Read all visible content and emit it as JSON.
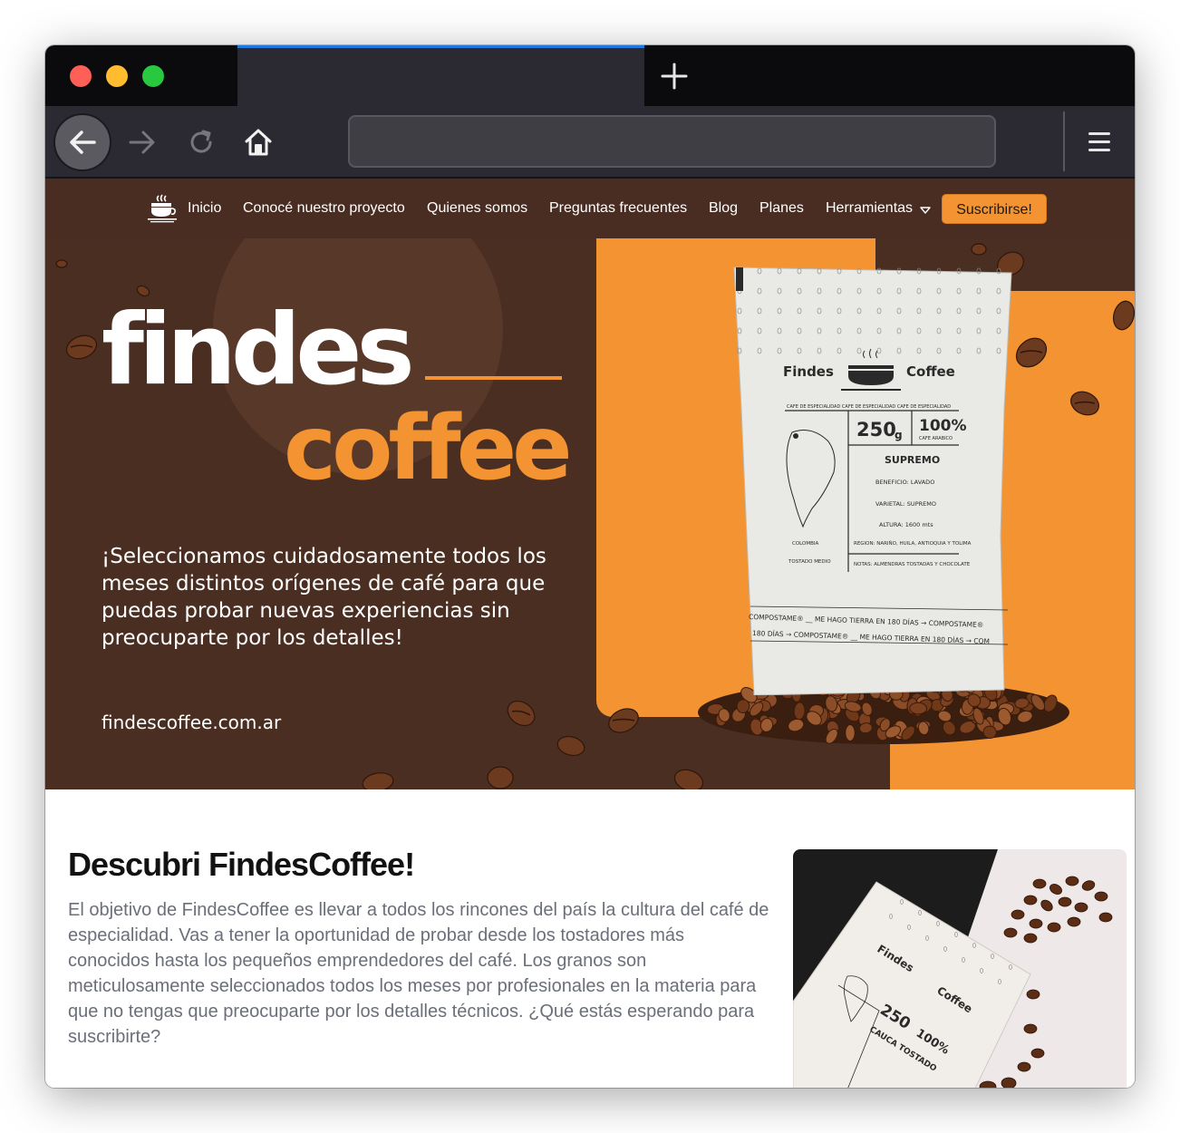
{
  "browser": {
    "tab_title": "",
    "url": "",
    "new_tab_icon": "plus-icon",
    "colors": {
      "tabbar": "#0b0b0d",
      "toolbar": "#2b2a33",
      "active_tab_accent": "#1f7ae0"
    }
  },
  "nav": {
    "items": [
      "Inicio",
      "Conocé nuestro proyecto",
      "Quienes somos",
      "Preguntas frecuentes",
      "Blog",
      "Planes",
      "Herramientas"
    ],
    "subscribe_label": "Suscribirse!",
    "colors": {
      "background": "#4a2d22",
      "accent": "#f39331"
    }
  },
  "hero": {
    "title": "findes",
    "subtitle": "coffee",
    "text": "¡Seleccionamos cuidadosamente todos los meses distintos orígenes de café para que puedas probar nuevas experiencias sin preocuparte por los detalles!",
    "url": "findescoffee.com.ar",
    "bag": {
      "brand_left": "Findes",
      "brand_right": "Coffee",
      "weight": "250",
      "weight_unit": "g",
      "percent": "100%",
      "percent_sub": "CAFE ARABICO",
      "band": "CAFE DE ESPECIALIDAD  CAFE DE ESPECIALIDAD  CAFE DE ESPECIALIDAD",
      "variety_title": "SUPREMO",
      "beneficio": "BENEFICIO: LAVADO",
      "varietal": "VARIETAL: SUPREMO",
      "altura": "ALTURA: 1600 mts",
      "region": "REGION: NARIÑO, HUILA, ANTIOQUIA Y TOLIMA",
      "notas": "NOTAS: ALMENDRAS TOSTADAS Y CHOCOLATE",
      "country": "COLOMBIA",
      "roast": "TOSTADO MEDIO",
      "footer_1": "COMPOSTAME® __ ME HAGO TIERRA EN 180 DÍAS → COMPOSTAME®",
      "footer_2": "180 DÍAS → COMPOSTAME® __ ME HAGO TIERRA EN 180 DÍAS → COM"
    }
  },
  "section": {
    "title": "Descubri FindesCoffee!",
    "text": "El objetivo de FindesCoffee es llevar a todos los rincones del país la cultura del café de especialidad. Vas a tener la oportunidad de probar desde los tostadores más conocidos hasta los pequeños emprendedores del café. Los granos son meticulosamente seleccionados todos los meses por profesionales en la materia para que no tengas que preocuparte por los detalles técnicos. ¿Qué estás esperando para suscribirte?",
    "photo": {
      "brand_left": "Findes",
      "brand_right": "Coffee",
      "weight": "250",
      "percent": "100%",
      "variety_title": "CAUCA TOSTADO"
    }
  }
}
